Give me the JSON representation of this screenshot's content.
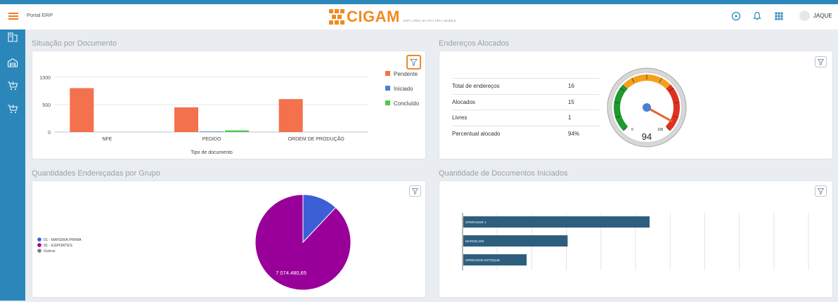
{
  "header": {
    "portal_title": "Portal ERP",
    "logo_text": "CIGAM",
    "logo_subtitle": "ERP | CRM | BI | RH | PDV | MOBILE",
    "user_name": "JAQUE",
    "accent_color": "#2b87b9",
    "brand_color": "#f08a1e"
  },
  "sections": {
    "situacao": "Situação por Documento",
    "enderecos": "Endereços Alocados",
    "quantidades": "Quantidades Endereçadas por Grupo",
    "documentos": "Quantidade de Documentos Iniciados"
  },
  "enderecos_table": {
    "rows": [
      {
        "label": "Total de endereços",
        "value": "16"
      },
      {
        "label": "Alocados",
        "value": "15"
      },
      {
        "label": "Livres",
        "value": "1"
      },
      {
        "label": "Percentual alocado",
        "value": "94%"
      }
    ]
  },
  "chart_data": [
    {
      "type": "bar",
      "categories": [
        "NFE",
        "PEDIDO",
        "ORDEM DE PRODUÇÃO"
      ],
      "series": [
        {
          "name": "Pendente",
          "color": "#f4714d",
          "values": [
            800,
            450,
            600
          ]
        },
        {
          "name": "Iniciado",
          "color": "#4f7fd0",
          "values": [
            0,
            10,
            0
          ]
        },
        {
          "name": "Concluído",
          "color": "#4cc94c",
          "values": [
            0,
            30,
            0
          ]
        }
      ],
      "xlabel": "Tipo de documento",
      "yticks": [
        "0",
        "500",
        "1000"
      ],
      "ylim": [
        0,
        1100
      ],
      "legend": "right"
    },
    {
      "type": "gauge",
      "value": 94,
      "min": 0,
      "max": 100,
      "value_label": "94",
      "min_label": "0",
      "max_label": "100"
    },
    {
      "type": "pie",
      "slices": [
        {
          "name": "01 - MATERIA PRIMA",
          "value": 12,
          "color": "#3c5fd6"
        },
        {
          "name": "91 - ESPORTES",
          "value": 88,
          "color": "#990099"
        },
        {
          "name": "Outros",
          "value": 0,
          "color": "#7f7f7f"
        }
      ],
      "slice_label": "7 074.480,65",
      "legend": "left"
    },
    {
      "type": "bar",
      "orientation": "horizontal",
      "categories": [
        "OPERADOR 1",
        "MARCELOW",
        "OPERADOR ESTOQUE"
      ],
      "values": [
        100,
        56,
        34
      ],
      "color": "#2e5e7e"
    }
  ]
}
